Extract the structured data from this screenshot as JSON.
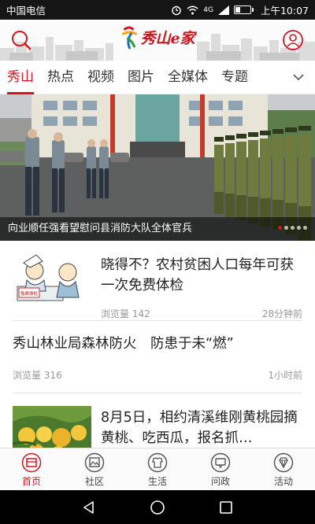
{
  "status_bar": {
    "carrier": "中国电信",
    "signal": "4G",
    "battery": "",
    "time": "上午10:07"
  },
  "header": {
    "logo_text": "秀山e家",
    "search_icon": "search-icon",
    "user_icon": "user-icon"
  },
  "tabs": [
    {
      "label": "秀山",
      "active": true
    },
    {
      "label": "热点",
      "active": false
    },
    {
      "label": "视频",
      "active": false
    },
    {
      "label": "图片",
      "active": false
    },
    {
      "label": "全媒体",
      "active": false
    },
    {
      "label": "专题",
      "active": false
    }
  ],
  "banner": {
    "caption": "向业顺任强看望慰问县消防大队全体官兵",
    "slide_count": 5,
    "active_slide": 1
  },
  "news": [
    {
      "title": "晓得不？农村贫困人口每年可获一次免费体检",
      "views_label": "浏览量 142",
      "time": "28分钟前",
      "thumb_label": "免费体检"
    },
    {
      "title": "秀山林业局森林防火　防患于未“燃”",
      "views_label": "浏览量 316",
      "time": "1小时前"
    },
    {
      "title": "8月5日，相约清溪维刚黄桃园摘黄桃、吃西瓜，报名抓…"
    }
  ],
  "bottom_nav": [
    {
      "label": "首页",
      "icon": "home-icon",
      "active": true
    },
    {
      "label": "社区",
      "icon": "community-icon",
      "active": false
    },
    {
      "label": "生活",
      "icon": "life-icon",
      "active": false
    },
    {
      "label": "问政",
      "icon": "inquiry-icon",
      "active": false
    },
    {
      "label": "活动",
      "icon": "activity-icon",
      "active": false
    }
  ],
  "colors": {
    "accent": "#d0161f",
    "text": "#222222",
    "meta": "#999999"
  }
}
